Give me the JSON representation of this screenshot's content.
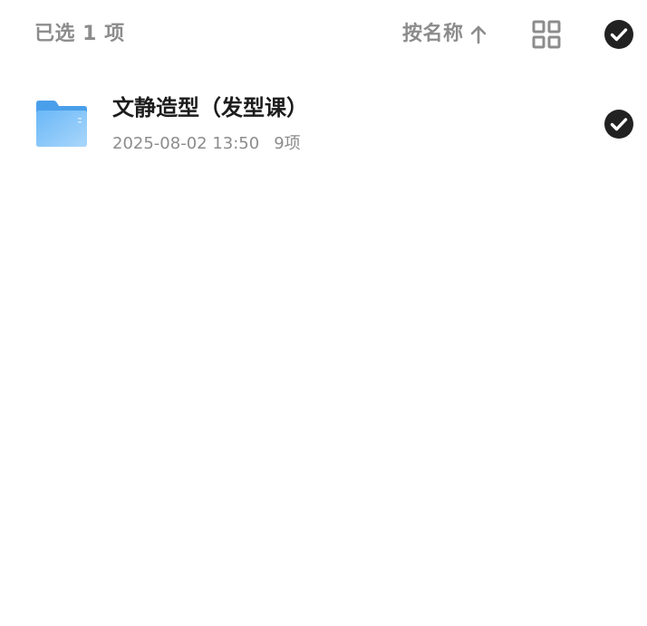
{
  "header": {
    "selected_count": "已选 1 项",
    "sort_label": "按名称",
    "sort_direction": "ascending",
    "view_icon": "grid-icon",
    "select_all_icon": "check-circle-icon",
    "select_all_checked": true
  },
  "files": [
    {
      "name": "文静造型（发型课）",
      "date": "2025-08-02 13:50",
      "item_count": "9项",
      "type": "folder",
      "icon": "folder-icon",
      "selected": true
    }
  ],
  "colors": {
    "muted_text": "#8c8c8c",
    "primary_text": "#1c1c1c",
    "check_fill": "#222222",
    "folder_blue": "#5aaef5"
  }
}
